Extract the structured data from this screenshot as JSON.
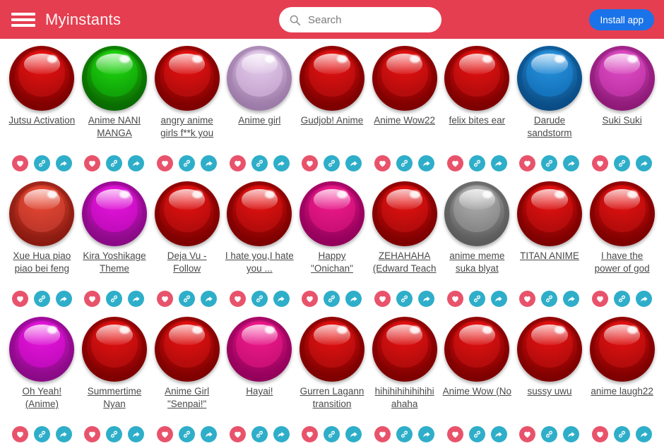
{
  "header": {
    "menu_icon": "hamburger-icon",
    "brand": "Myinstants",
    "search": {
      "icon": "search-icon",
      "placeholder": "Search",
      "value": ""
    },
    "install_label": "Install app",
    "colors": {
      "header_bg": "#e53e51",
      "install_bg": "#1a73e8",
      "brand_text": "#fff4f2"
    }
  },
  "actions": {
    "favorite_icon": "heart-icon",
    "link_icon": "link-icon",
    "share_icon": "share-icon",
    "favorite_color": "#e8536b",
    "link_color": "#2eaec9",
    "share_color": "#2eaec9"
  },
  "grid": {
    "columns": 9,
    "items": [
      {
        "label": "Jutsu Activation",
        "color": "red"
      },
      {
        "label": "Anime NANI MANGA",
        "color": "green"
      },
      {
        "label": "angry anime girls f**k you",
        "color": "red"
      },
      {
        "label": "Anime girl",
        "color": "lilac"
      },
      {
        "label": "Gudjob! Anime",
        "color": "red"
      },
      {
        "label": "Anime Wow22",
        "color": "red"
      },
      {
        "label": "felix bites ear",
        "color": "red"
      },
      {
        "label": "Darude sandstorm",
        "color": "blue"
      },
      {
        "label": "Suki Suki",
        "color": "orchid"
      },
      {
        "label": "Xue Hua piao piao bei feng",
        "color": "tomato"
      },
      {
        "label": "Kira Yoshikage Theme",
        "color": "magenta"
      },
      {
        "label": "Deja Vu - Follow",
        "color": "red"
      },
      {
        "label": "I hate you,I hate you ...",
        "color": "red"
      },
      {
        "label": "Happy \"Onichan\"",
        "color": "pink"
      },
      {
        "label": "ZEHAHAHA (Edward Teach",
        "color": "red"
      },
      {
        "label": "anime meme suka blyat",
        "color": "gray"
      },
      {
        "label": "TITAN ANIME",
        "color": "red"
      },
      {
        "label": "I have the power of god",
        "color": "red"
      },
      {
        "label": "Oh Yeah! (Anime)",
        "color": "magenta"
      },
      {
        "label": "Summertime Nyan",
        "color": "red"
      },
      {
        "label": "Anime Girl \"Senpai!\"",
        "color": "red"
      },
      {
        "label": "Hayai!",
        "color": "pink"
      },
      {
        "label": "Gurren Lagann transition",
        "color": "red"
      },
      {
        "label": "hihihihihihihihi ahaha",
        "color": "red"
      },
      {
        "label": "Anime Wow (No",
        "color": "red"
      },
      {
        "label": "sussy uwu",
        "color": "red"
      },
      {
        "label": "anime laugh22",
        "color": "red"
      }
    ],
    "palette": {
      "red": {
        "base": "#7e0000",
        "ring": "#b40c0c",
        "top": "#ee1111"
      },
      "green": {
        "base": "#0a6b00",
        "ring": "#10a408",
        "top": "#22dd10"
      },
      "lilac": {
        "base": "#9d7ba8",
        "ring": "#c9a8d2",
        "top": "#e6cfee"
      },
      "blue": {
        "base": "#0a4d86",
        "ring": "#1474bd",
        "top": "#2b95e0"
      },
      "orchid": {
        "base": "#8e1a78",
        "ring": "#c134a8",
        "top": "#e250c8"
      },
      "tomato": {
        "base": "#8a1a10",
        "ring": "#c0382b",
        "top": "#ef4a32"
      },
      "magenta": {
        "base": "#8a0a86",
        "ring": "#c40cbe",
        "top": "#ea16e0"
      },
      "pink": {
        "base": "#93005b",
        "ring": "#cc1077",
        "top": "#f41a8f"
      },
      "gray": {
        "base": "#5b5b5b",
        "ring": "#888888",
        "top": "#b4b4b4"
      }
    }
  }
}
